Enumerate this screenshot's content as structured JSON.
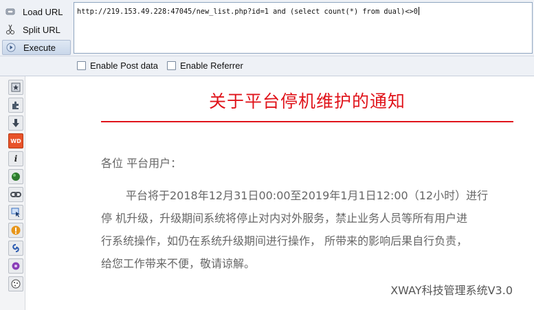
{
  "hackbar": {
    "load_label": "Load URL",
    "split_label": "Split URL",
    "execute_label": "Execute",
    "url_value": "http://219.153.49.228:47045/new_list.php?id=1 and (select count(*) from dual)<>0",
    "post_label": "Enable Post data",
    "referrer_label": "Enable Referrer"
  },
  "sidebar": {
    "icons": [
      "star-icon",
      "puzzle-icon",
      "download-arrow-icon",
      "webdeveloper-icon",
      "info-icon",
      "green-orb-icon",
      "link-icon",
      "cursor-select-icon",
      "warning-icon",
      "swirl-icon",
      "purple-gear-icon",
      "cookie-icon"
    ]
  },
  "notice": {
    "title": "关于平台停机维护的通知",
    "greeting": "各位 平台用户：",
    "line1": "平台将于2018年12月31日00:00至2019年1月1日12:00（12小时）进行",
    "line2": "停 机升级，升级期间系统将停止对内对外服务，禁止业务人员等所有用户进",
    "line3": "行系统操作，如仍在系统升级期间进行操作， 所带来的影响后果自行负责，",
    "line4": "给您工作带来不便，敬请谅解。",
    "signature": "XWAY科技管理系统V3.0"
  },
  "colors": {
    "title": "#e0141b",
    "body_text": "#666666",
    "toolbar_bg": "#eef1f6"
  }
}
